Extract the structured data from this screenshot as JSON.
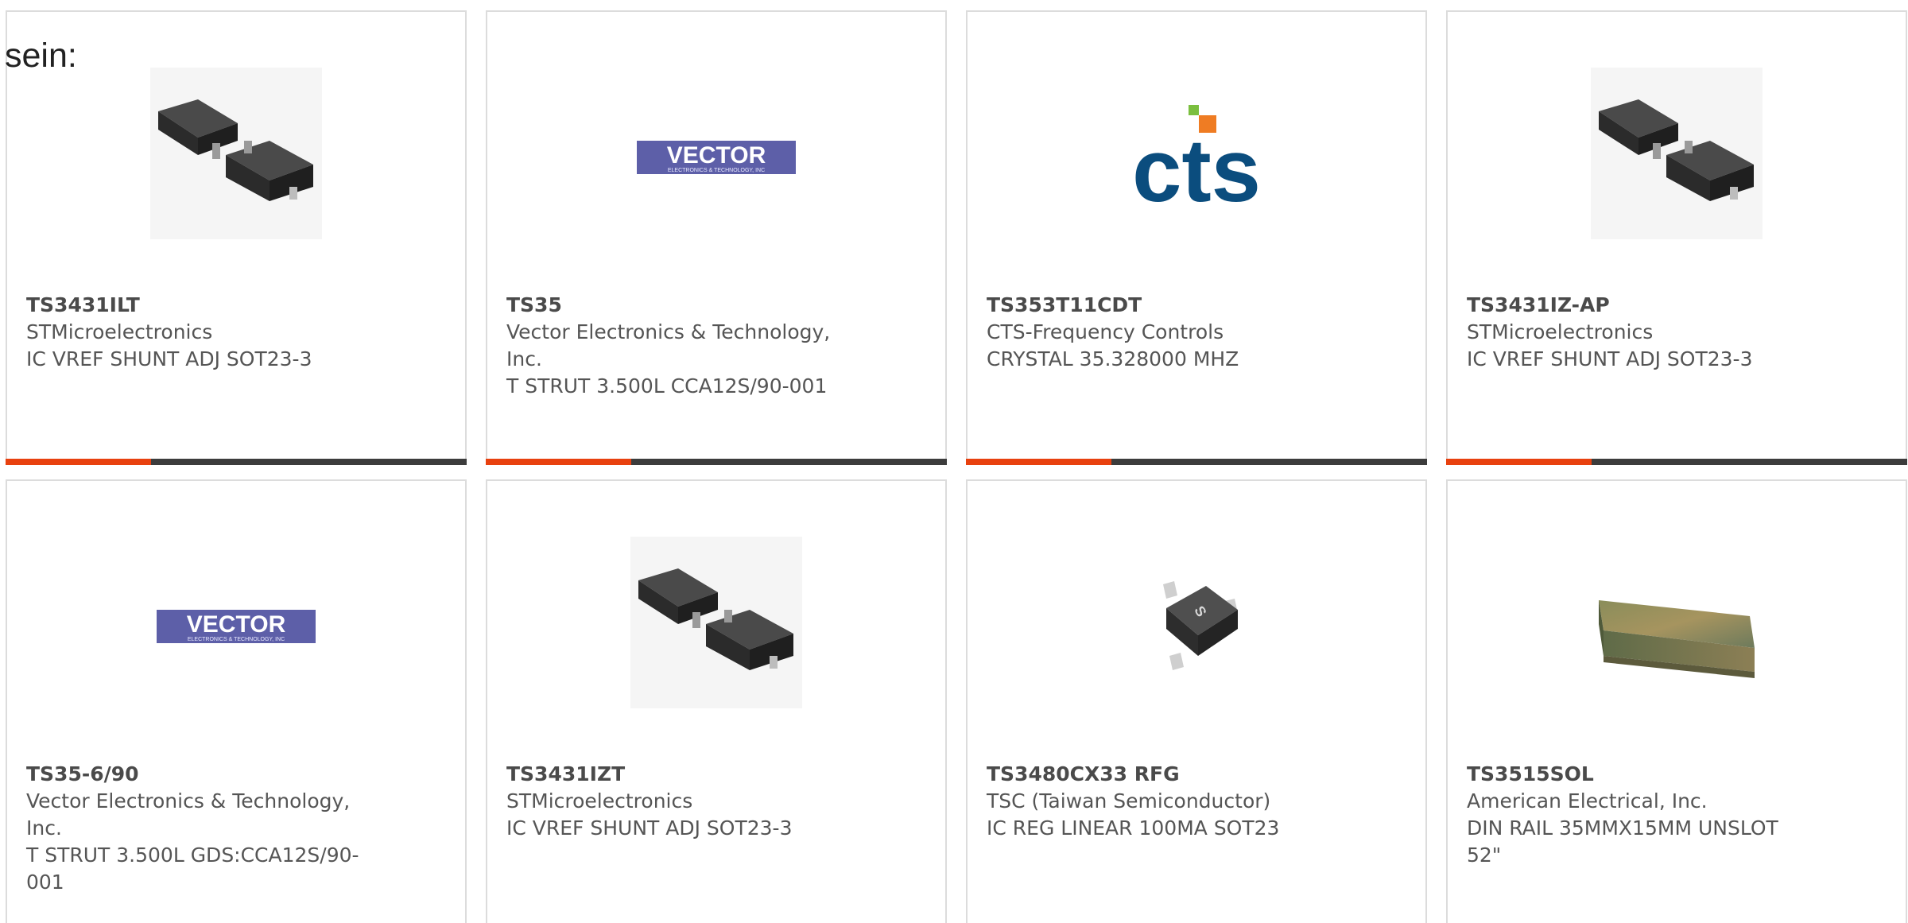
{
  "intro": {
    "text": "sein:"
  },
  "colors": {
    "accent": "#e8410f",
    "bar": "#3c3c3c",
    "card_border": "#dcdcdc",
    "text": "#555555",
    "vector_logo_bg": "#5d5fa8",
    "cts_blue": "#0b4d7e",
    "cts_orange": "#ef7c23",
    "cts_green": "#7bbf3f"
  },
  "products": [
    {
      "part_number": "TS3431ILT",
      "manufacturer": "STMicroelectronics",
      "description": "IC VREF SHUNT ADJ SOT23-3",
      "image": "sot23-package"
    },
    {
      "part_number": "TS35",
      "manufacturer": "Vector Electronics & Technology, Inc.",
      "description": "T STRUT 3.500L CCA12S/90-001",
      "image": "vector-logo"
    },
    {
      "part_number": "TS353T11CDT",
      "manufacturer": "CTS-Frequency Controls",
      "description": "CRYSTAL 35.328000 MHZ",
      "image": "cts-logo"
    },
    {
      "part_number": "TS3431IZ-AP",
      "manufacturer": "STMicroelectronics",
      "description": "IC VREF SHUNT ADJ SOT23-3",
      "image": "sot23-package"
    },
    {
      "part_number": "TS35-6/90",
      "manufacturer": "Vector Electronics & Technology, Inc.",
      "description": "T STRUT 3.500L GDS:CCA12S/90-001",
      "image": "vector-logo"
    },
    {
      "part_number": "TS3431IZT",
      "manufacturer": "STMicroelectronics",
      "description": "IC VREF SHUNT ADJ SOT23-3",
      "image": "sot23-package"
    },
    {
      "part_number": "TS3480CX33 RFG",
      "manufacturer": "TSC (Taiwan Semiconductor)",
      "description": "IC REG LINEAR 100MA SOT23",
      "image": "sot23-single"
    },
    {
      "part_number": "TS3515SOL",
      "manufacturer": "American Electrical, Inc.",
      "description": "DIN RAIL 35MMX15MM UNSLOT 52\"",
      "image": "din-rail"
    }
  ],
  "logos": {
    "vector": {
      "word": "VECTOR",
      "tagline": "ELECTRONICS & TECHNOLOGY, INC"
    },
    "cts": {
      "word": "cts"
    }
  },
  "chip_marking": "S"
}
